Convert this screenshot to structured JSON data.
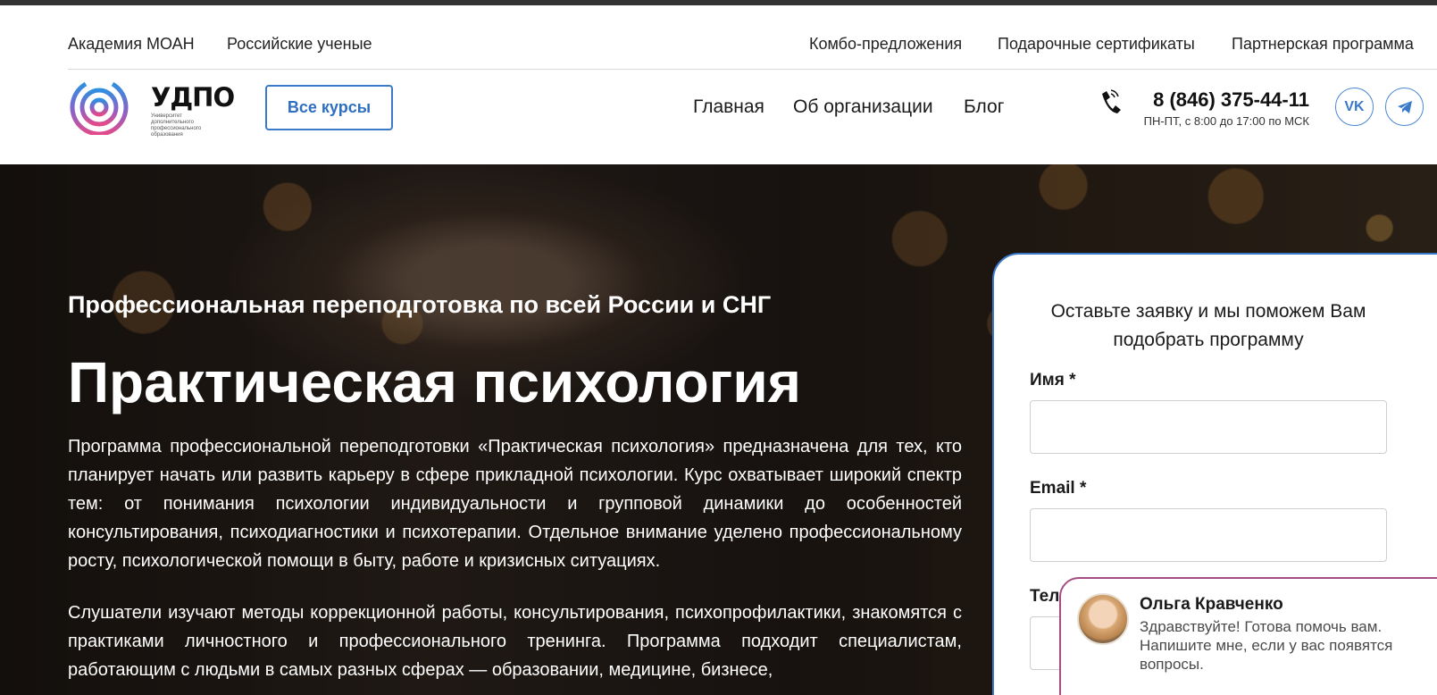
{
  "util_nav": {
    "left": [
      "Академия МОАН",
      "Российские ученые"
    ],
    "right": [
      "Комбо-предложения",
      "Подарочные сертификаты",
      "Партнерская программа"
    ]
  },
  "logo": {
    "title": "УДПО",
    "subtitle": "Университет дополнительного профессионального образования"
  },
  "header": {
    "all_courses": "Все курсы",
    "nav": [
      "Главная",
      "Об организации",
      "Блог"
    ],
    "phone": "8 (846) 375-44-11",
    "hours": "ПН-ПТ, с 8:00 до 17:00 по МСК",
    "social": [
      "vk-icon",
      "telegram-icon"
    ]
  },
  "hero": {
    "subtitle": "Профессиональная переподготовка по всей России и СНГ",
    "title": "Практическая психология",
    "paragraph1": "Программа профессиональной переподготовки «Практическая психология» предназначена для тех, кто планирует начать или развить карьеру в сфере прикладной психологии. Курс охватывает широкий спектр тем: от понимания психологии индивидуальности и групповой динамики до особенностей консультирования, психодиагностики и психотерапии. Отдельное внимание уделено профессиональному росту, психологической помощи в быту, работе и кризисных ситуациях.",
    "paragraph2": "Слушатели изучают методы коррекционной работы, консультирования, психопрофилактики, знакомятся с практиками личностного и профессионального тренинга. Программа подходит специалистам, работающим с людьми в самых разных сферах — образовании, медицине, бизнесе,"
  },
  "form": {
    "heading": "Оставьте заявку и мы поможем Вам подобрать программу",
    "name_label": "Имя *",
    "email_label": "Email *",
    "phone_label": "Телефон *"
  },
  "chat": {
    "name": "Ольга Кравченко",
    "message": "Здравствуйте! Готова помочь вам. Напишите мне, если у вас появятся вопросы."
  },
  "colors": {
    "accent": "#3b7ac9",
    "chat_border": "#a34d82"
  }
}
